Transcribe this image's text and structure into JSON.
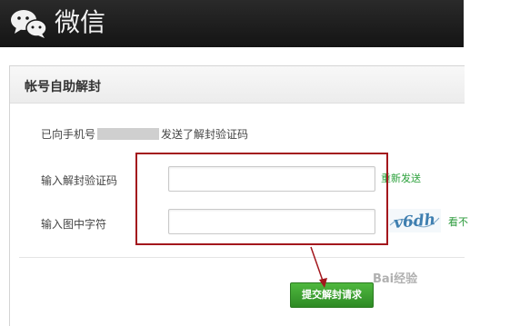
{
  "header": {
    "brand": "微信",
    "logo_icon": "wechat-logo-icon"
  },
  "panel": {
    "title": "帐号自助解封"
  },
  "info": {
    "prefix": "已向手机号",
    "suffix": "发送了解封验证码"
  },
  "form": {
    "code_label": "输入解封验证码",
    "code_value": "",
    "resend_label": "重新发送",
    "captcha_label": "输入图中字符",
    "captcha_value": "",
    "captcha_image_text": "v6dh",
    "cant_see_label": "看不",
    "submit_label": "提交解封请求"
  },
  "watermark": "Bai经验",
  "colors": {
    "header_bg": "#1c1c1c",
    "accent_green": "#2e8a24",
    "highlight_red": "#a3171d"
  }
}
